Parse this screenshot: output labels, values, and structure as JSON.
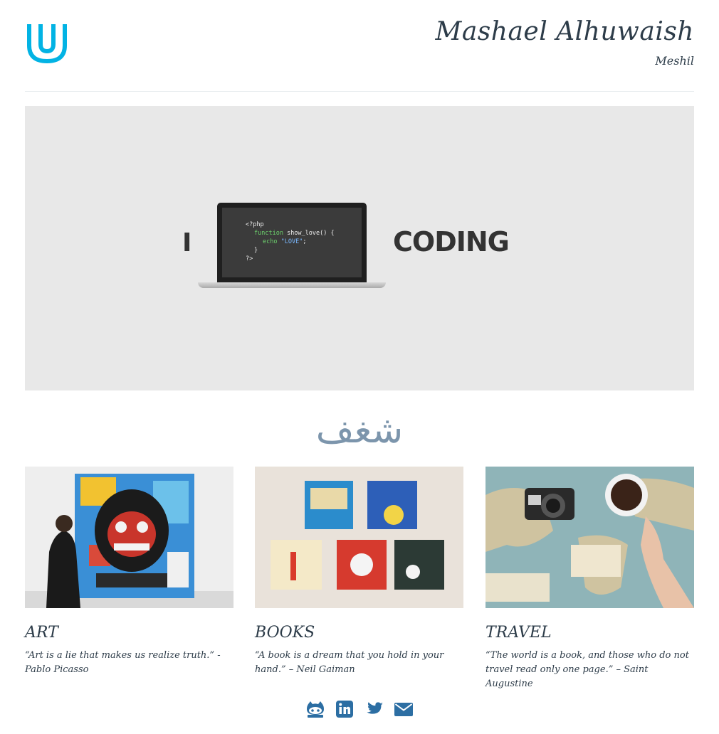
{
  "header": {
    "name": "Mashael Alhuwaish",
    "nickname": "Meshil",
    "brand_color": "#02b3e4"
  },
  "hero": {
    "left_text": "I",
    "right_text": "CODING",
    "code": {
      "line1": "<?php",
      "line2_keyword": "function",
      "line2_rest": " show_love() {",
      "line3_keyword": "echo",
      "line3_string": " \"LOVE\"",
      "line3_end": ";",
      "line4": "}",
      "line5": "?>"
    }
  },
  "section_title": "شغف",
  "cards": [
    {
      "title": "ART",
      "quote": "“Art is a lie that makes us realize truth.” -Pablo Picasso"
    },
    {
      "title": "BOOKS",
      "quote": "“A book is a dream that you hold in your hand.” – Neil Gaiman"
    },
    {
      "title": "TRAVEL",
      "quote": "“The world is a book, and those who do not travel read only one page.” – Saint Augustine"
    }
  ],
  "social": {
    "icons": [
      "github-icon",
      "linkedin-icon",
      "twitter-icon",
      "email-icon"
    ],
    "color": "#2c6ea3"
  }
}
